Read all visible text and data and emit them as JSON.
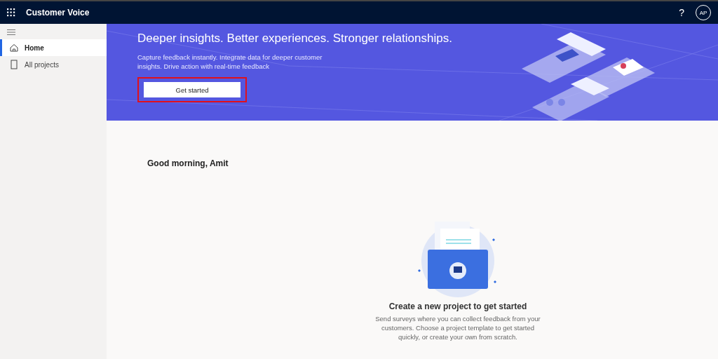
{
  "app_bar": {
    "title": "Customer Voice",
    "help": "?",
    "avatar": "AP"
  },
  "sidebar": {
    "items": [
      {
        "label": "Home",
        "selected": true
      },
      {
        "label": "All projects",
        "selected": false
      }
    ]
  },
  "banner": {
    "heading": "Deeper insights. Better experiences. Stronger relationships.",
    "text": "Capture feedback instantly. Integrate data for deeper customer insights. Drive action with real-time feedback",
    "button": {
      "label": "Get started",
      "highlighted": true
    }
  },
  "greeting": "Good morning, Amit",
  "empty_state": {
    "title": "Create a new project to get started",
    "text": "Send surveys where you can collect feedback from your customers. Choose a project template to get started quickly, or create your own from scratch."
  }
}
